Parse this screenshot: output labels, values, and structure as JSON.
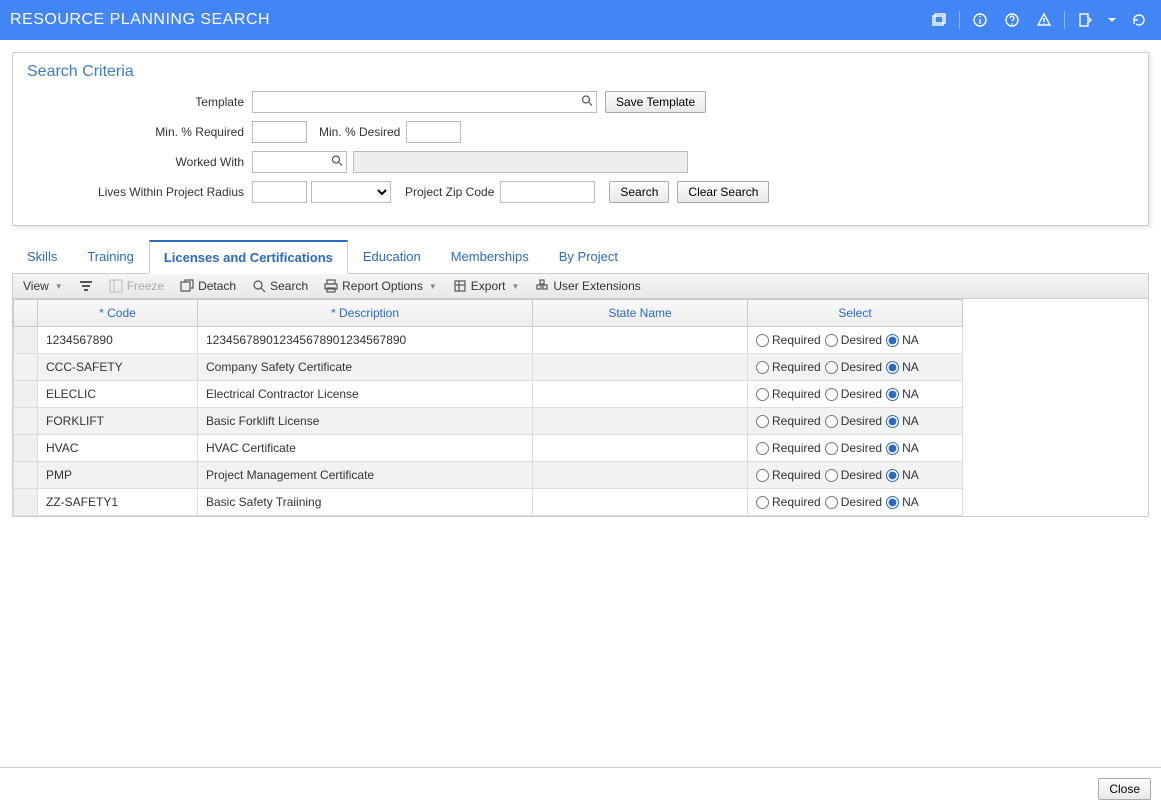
{
  "header": {
    "title": "RESOURCE PLANNING SEARCH"
  },
  "search_panel": {
    "title": "Search Criteria",
    "template_label": "Template",
    "save_template": "Save Template",
    "min_required_label": "Min. % Required",
    "min_desired_label": "Min. % Desired",
    "worked_with_label": "Worked With",
    "radius_label": "Lives Within Project Radius",
    "zip_label": "Project Zip Code",
    "search_btn": "Search",
    "clear_btn": "Clear Search"
  },
  "tabs": {
    "items": [
      {
        "label": "Skills"
      },
      {
        "label": "Training"
      },
      {
        "label": "Licenses and Certifications"
      },
      {
        "label": "Education"
      },
      {
        "label": "Memberships"
      },
      {
        "label": "By Project"
      }
    ],
    "active_index": 2
  },
  "toolbar": {
    "view": "View",
    "freeze": "Freeze",
    "detach": "Detach",
    "search": "Search",
    "report_options": "Report Options",
    "export": "Export",
    "user_extensions": "User Extensions"
  },
  "table": {
    "columns": {
      "code": "* Code",
      "description": "* Description",
      "state": "State Name",
      "select": "Select"
    },
    "select_options": {
      "required": "Required",
      "desired": "Desired",
      "na": "NA"
    },
    "rows": [
      {
        "code": "1234567890",
        "description": "123456789012345678901234567890",
        "state": "",
        "select": "NA"
      },
      {
        "code": "CCC-SAFETY",
        "description": "Company Safety Certificate",
        "state": "",
        "select": "NA"
      },
      {
        "code": "ELECLIC",
        "description": "Electrical Contractor License",
        "state": "",
        "select": "NA"
      },
      {
        "code": "FORKLIFT",
        "description": "Basic Forklift License",
        "state": "",
        "select": "NA"
      },
      {
        "code": "HVAC",
        "description": "HVAC Certificate",
        "state": "",
        "select": "NA"
      },
      {
        "code": "PMP",
        "description": "Project Management Certificate",
        "state": "",
        "select": "NA"
      },
      {
        "code": "ZZ-SAFETY1",
        "description": "Basic Safety Traiining",
        "state": "",
        "select": "NA"
      }
    ]
  },
  "footer": {
    "close": "Close"
  }
}
